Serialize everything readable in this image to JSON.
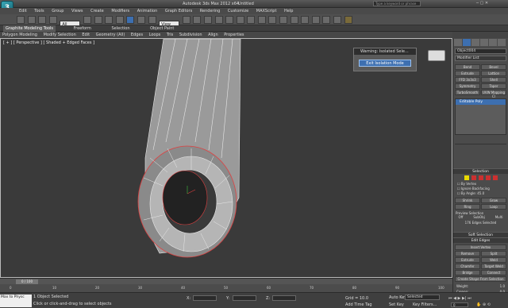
{
  "app": {
    "title": "Autodesk 3ds Max 2012 x64",
    "file": "Untitled",
    "search_placeholder": "Type a keyword or phrase",
    "logo": "3"
  },
  "menu": [
    "Edit",
    "Tools",
    "Group",
    "Views",
    "Create",
    "Modifiers",
    "Animation",
    "Graph Editors",
    "Rendering",
    "Customize",
    "MAXScript",
    "Help"
  ],
  "toolbar": {
    "selection_filter": "All",
    "ref_coord": "View"
  },
  "ribbon": {
    "tabs1": [
      "Graphite Modeling Tools",
      "Freeform",
      "Selection",
      "Object Paint"
    ],
    "tabs2": [
      "Polygon Modeling",
      "Modify Selection",
      "Edit",
      "Geometry (All)",
      "Edges",
      "Loops",
      "Tris",
      "Subdivision",
      "Align",
      "Properties"
    ]
  },
  "viewport": {
    "label": "[ + ] [ Perspective ] [ Shaded + Edged Faces ]"
  },
  "dialog": {
    "title": "Warning: Isolated Sele...",
    "button": "Exit Isolation Mode"
  },
  "panel": {
    "object_name": "Object004",
    "modifier_list": "Modifier List",
    "buttons": [
      [
        "Bend",
        "Bevel"
      ],
      [
        "Extrude",
        "Lattice"
      ],
      [
        "FFD 3x3x3",
        "Shell"
      ],
      [
        "Symmetry",
        "Taper"
      ],
      [
        "TurboSmooth",
        "UVW Mapping Cl"
      ]
    ],
    "stack_item": "Editable Poly",
    "selection_header": "Selection",
    "by_vertex": "By Vertex",
    "ignore_backfacing": "Ignore Backfacing",
    "by_angle": "By Angle:",
    "angle_value": "45.0",
    "shrink": "Shrink",
    "grow": "Grow",
    "ring": "Ring",
    "loop": "Loop",
    "preview_label": "Preview Selection",
    "preview_off": "Off",
    "preview_subobj": "SubObj",
    "preview_multi": "Multi",
    "selected_count": "176 Edges Selected",
    "soft_selection": "Soft Selection",
    "edit_edges": "Edit Edges",
    "insert_vertex": "Insert Vertex",
    "remove": "Remove",
    "split": "Split",
    "extrude": "Extrude",
    "weld": "Weld",
    "chamfer": "Chamfer",
    "target_weld": "Target Weld",
    "bridge": "Bridge",
    "connect": "Connect",
    "create_shape": "Create Shape From Selection",
    "weight_label": "Weight:",
    "weight_value": "1.0",
    "crease_label": "Crease:",
    "crease_value": "0.0"
  },
  "timeline": {
    "counter": "0 / 100",
    "ticks": [
      "0",
      "10",
      "20",
      "30",
      "40",
      "50",
      "60",
      "70",
      "80",
      "90",
      "100"
    ]
  },
  "status": {
    "script_box": "Max to Physc",
    "line1": "1 Object Selected",
    "line2": "Click or click-and-drag to select objects",
    "x_label": "X:",
    "y_label": "Y:",
    "z_label": "Z:",
    "grid": "Grid = 10.0",
    "auto_key": "Auto Key",
    "selected": "Selected",
    "set_key": "Set Key",
    "key_filters": "Key Filters...",
    "add_time_tag": "Add Time Tag",
    "frame": "0"
  },
  "colors": {
    "viewport_bg": "#3a3a3a",
    "selected_edge": "#e04040",
    "accent_blue": "#3d6fb0"
  }
}
